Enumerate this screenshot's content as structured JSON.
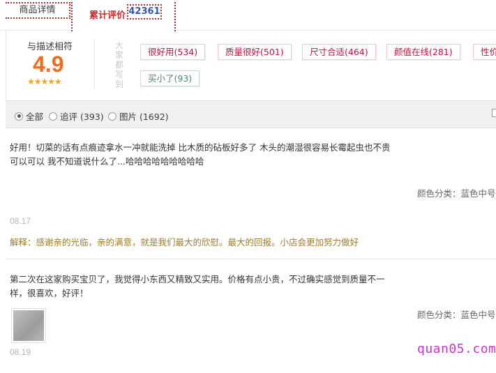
{
  "tabs": {
    "detail_label": "商品详情",
    "reviews_label": "累计评价",
    "reviews_count": "42361"
  },
  "summary": {
    "title": "与描述相符",
    "score": "4.9",
    "stars": "★★★★★",
    "caption": "大家都写到",
    "tags": [
      {
        "label": "很好用(534)"
      },
      {
        "label": "质量很好(501)"
      },
      {
        "label": "尺寸合适(464)"
      },
      {
        "label": "颜值在线(281)"
      },
      {
        "label": "性价"
      },
      {
        "label": "买小了(93)"
      }
    ]
  },
  "filters": {
    "options": [
      {
        "label": "全部",
        "checked": true
      },
      {
        "label": "追评 (393)",
        "checked": false
      },
      {
        "label": "图片 (1692)",
        "checked": false
      }
    ]
  },
  "reviews": [
    {
      "text": "好用！切菜的话有点痕迹拿水一冲就能洗掉 比木质的砧板好多了 木头的潮湿很容易长霉起虫也不贵 可以可以 我不知道说什么了...哈哈哈哈哈哈哈哈哈",
      "sku_label": "颜色分类：",
      "sku_value": "蓝色中号",
      "date": "08.17",
      "reply": "解释：感谢亲的光临，亲的满意，就是我们最大的欣慰。最大的回报。小店会更加努力做好"
    },
    {
      "text": "第二次在这家购买宝贝了，我觉得小东西又精致又实用。价格有点小贵，不过确实感觉到质量不一样，很喜欢，好评！",
      "sku_label": "颜色分类：",
      "sku_value": "蓝色中号",
      "date": "08.19"
    }
  ],
  "watermark": "quan05.com",
  "colors": {
    "accent_red": "#d4242c",
    "score_orange": "#f26c1a",
    "star_yellow": "#f7a21b",
    "reply_gold": "#a07d2c",
    "tag_red": "#c0123c"
  }
}
